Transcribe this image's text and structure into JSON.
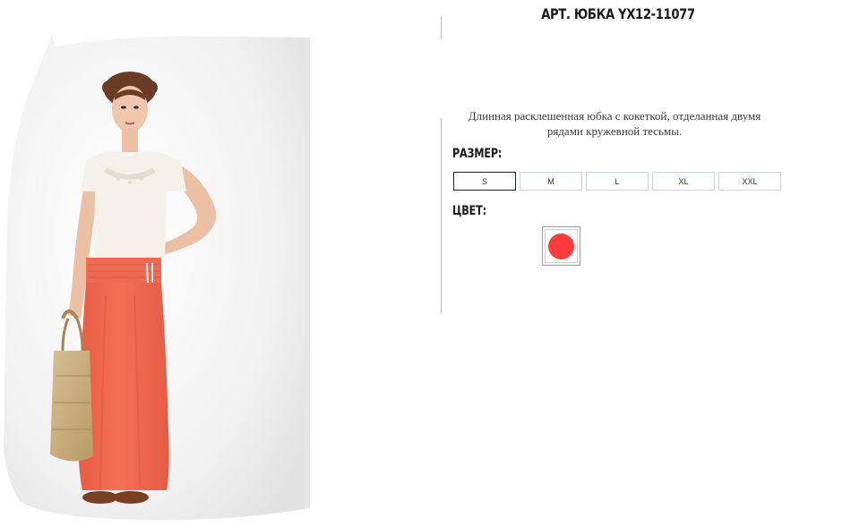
{
  "product": {
    "title": "АРТ. ЮБКА YX12-11077",
    "description_line1": "Длинная расклешенная юбка с кокеткой, отделанная двумя",
    "description_line2": "рядами кружевной тесьмы.",
    "photo_icon": "product-photo"
  },
  "size_section": {
    "label": "РАЗМЕР:",
    "options": [
      "S",
      "M",
      "L",
      "XL",
      "XXL"
    ],
    "selected": "S"
  },
  "color_section": {
    "label": "ЦВЕТ:",
    "swatches": [
      {
        "color": "#ff3b3b",
        "selected": true
      }
    ]
  },
  "colors": {
    "skirt": "#f26a52",
    "top": "#f3f0ea",
    "divider": "#bdbdbd"
  }
}
